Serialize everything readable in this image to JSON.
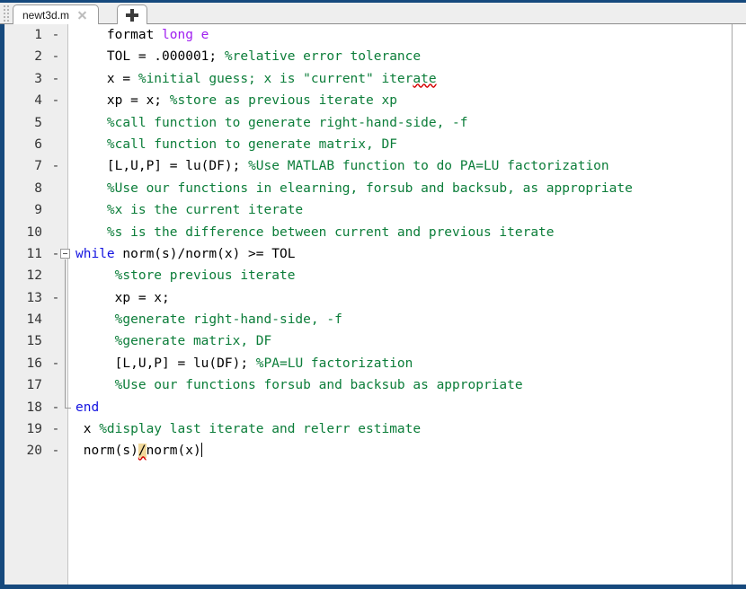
{
  "window": {
    "accent_color": "#16497d",
    "tabbar_bg": "#eeeeee",
    "editor_bg": "#ffffff",
    "gutter_bg": "#eeeeee"
  },
  "tabbar": {
    "grip_icon": "drag-grip-icon",
    "tab_label": "newt3d.m",
    "close_icon": "close-icon",
    "newtab_icon": "plus-icon",
    "newtab_label": "+"
  },
  "editor": {
    "language": "matlab",
    "cursor_line": 20,
    "colors": {
      "comment": "#0b7d39",
      "keyword": "#1212e0",
      "command_arg": "#a020f0",
      "plain": "#000000",
      "error_underline": "#d40000",
      "operator_highlight": "#f2d99b"
    },
    "lines": [
      {
        "number": "1",
        "marker": "-",
        "text": "format long e",
        "tokens": [
          {
            "kind": "plain",
            "text": "    format "
          },
          {
            "kind": "arg",
            "text": "long e"
          }
        ]
      },
      {
        "number": "2",
        "marker": "-",
        "text": "TOL = .000001; %relative error tolerance",
        "tokens": [
          {
            "kind": "plain",
            "text": "    TOL = .000001; "
          },
          {
            "kind": "comment",
            "text": "%relative error tolerance"
          }
        ]
      },
      {
        "number": "3",
        "marker": "-",
        "text": "x = %initial guess; x is \"current\" iterate",
        "tokens": [
          {
            "kind": "plain",
            "text": "    x = "
          },
          {
            "kind": "comment",
            "text": "%initial guess; x is \"current\" iter"
          },
          {
            "kind": "comment-error",
            "text": "ate"
          }
        ]
      },
      {
        "number": "4",
        "marker": "-",
        "text": "xp = x; %store as previous iterate xp",
        "tokens": [
          {
            "kind": "plain",
            "text": "    xp = x; "
          },
          {
            "kind": "comment",
            "text": "%store as previous iterate xp"
          }
        ]
      },
      {
        "number": "5",
        "marker": "",
        "text": "%call function to generate right-hand-side, -f",
        "tokens": [
          {
            "kind": "comment",
            "text": "    %call function to generate right-hand-side, -f"
          }
        ]
      },
      {
        "number": "6",
        "marker": "",
        "text": "%call function to generate matrix, DF",
        "tokens": [
          {
            "kind": "comment",
            "text": "    %call function to generate matrix, DF"
          }
        ]
      },
      {
        "number": "7",
        "marker": "-",
        "text": "[L,U,P] = lu(DF); %Use MATLAB function to do PA=LU factorization",
        "tokens": [
          {
            "kind": "plain",
            "text": "    [L,U,P] = lu(DF); "
          },
          {
            "kind": "comment",
            "text": "%Use MATLAB function to do PA=LU factorization"
          }
        ]
      },
      {
        "number": "8",
        "marker": "",
        "text": "%Use our functions in elearning, forsub and backsub, as appropriate",
        "tokens": [
          {
            "kind": "comment",
            "text": "    %Use our functions in elearning, forsub and backsub, as appropriate"
          }
        ]
      },
      {
        "number": "9",
        "marker": "",
        "text": "%x is the current iterate",
        "tokens": [
          {
            "kind": "comment",
            "text": "    %x is the current iterate"
          }
        ]
      },
      {
        "number": "10",
        "marker": "",
        "text": "%s is the difference between current and previous iterate",
        "tokens": [
          {
            "kind": "comment",
            "text": "    %s is the difference between current and previous iterate"
          }
        ]
      },
      {
        "number": "11",
        "marker": "-",
        "fold": "open",
        "text": "while norm(s)/norm(x) >= TOL",
        "tokens": [
          {
            "kind": "keyword",
            "text": "while"
          },
          {
            "kind": "plain",
            "text": " norm(s)/norm(x) >= TOL"
          }
        ]
      },
      {
        "number": "12",
        "marker": "",
        "text": "    %store previous iterate",
        "tokens": [
          {
            "kind": "comment",
            "text": "     %store previous iterate"
          }
        ]
      },
      {
        "number": "13",
        "marker": "-",
        "text": "    xp = x;",
        "tokens": [
          {
            "kind": "plain",
            "text": "     xp = x;"
          }
        ]
      },
      {
        "number": "14",
        "marker": "",
        "text": "    %generate right-hand-side, -f",
        "tokens": [
          {
            "kind": "comment",
            "text": "     %generate right-hand-side, -f"
          }
        ]
      },
      {
        "number": "15",
        "marker": "",
        "text": "    %generate matrix, DF",
        "tokens": [
          {
            "kind": "comment",
            "text": "     %generate matrix, DF"
          }
        ]
      },
      {
        "number": "16",
        "marker": "-",
        "text": "    [L,U,P] = lu(DF); %PA=LU factorization",
        "tokens": [
          {
            "kind": "plain",
            "text": "     [L,U,P] = lu(DF); "
          },
          {
            "kind": "comment",
            "text": "%PA=LU factorization"
          }
        ]
      },
      {
        "number": "17",
        "marker": "",
        "text": "    %Use our functions forsub and backsub as appropriate",
        "tokens": [
          {
            "kind": "comment",
            "text": "     %Use our functions forsub and backsub as appropriate"
          }
        ]
      },
      {
        "number": "18",
        "marker": "-",
        "fold": "close",
        "text": "end",
        "tokens": [
          {
            "kind": "keyword",
            "text": "end"
          }
        ]
      },
      {
        "number": "19",
        "marker": "-",
        "text": "x %display last iterate and relerr estimate",
        "tokens": [
          {
            "kind": "plain",
            "text": " x "
          },
          {
            "kind": "comment",
            "text": "%display last iterate and relerr estimate"
          }
        ]
      },
      {
        "number": "20",
        "marker": "-",
        "text": "norm(s)/norm(x)",
        "tokens": [
          {
            "kind": "plain",
            "text": " norm(s)"
          },
          {
            "kind": "highlight",
            "text": "/"
          },
          {
            "kind": "plain",
            "text": "norm(x)"
          },
          {
            "kind": "caret",
            "text": ""
          }
        ]
      }
    ]
  }
}
